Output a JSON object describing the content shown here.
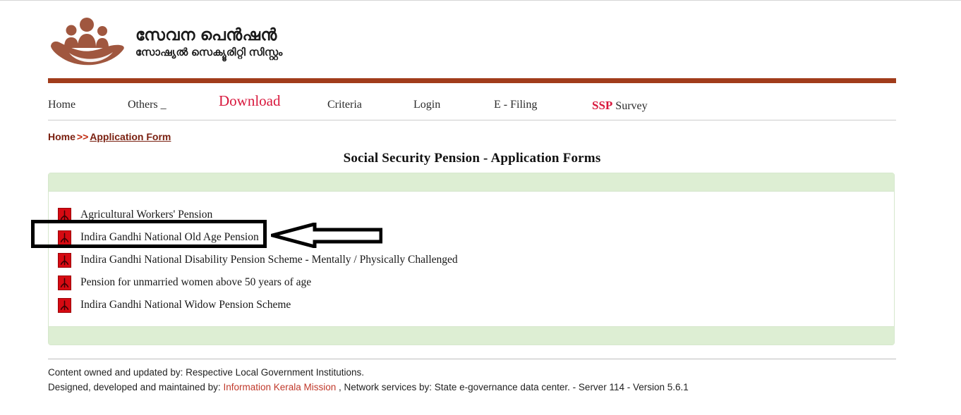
{
  "site": {
    "logo_icon": "hand-holding-people-icon",
    "title_ml": "സേവന പെൻഷൻ",
    "subtitle_ml": "സോഷ്യൽ സെക്യൂരിറ്റി സിസ്റ്റം",
    "accent_brown": "#a13c1b",
    "accent_red": "#d8173c",
    "panel_green": "#ddeed3"
  },
  "nav": {
    "items": [
      {
        "label": "Home"
      },
      {
        "label": "Others _"
      },
      {
        "label": "Download"
      },
      {
        "label": "Criteria"
      },
      {
        "label": "Login"
      },
      {
        "label": "E - Filing"
      },
      {
        "label": "SSP Survey",
        "accent_prefix": "SSP",
        "rest": " Survey"
      }
    ]
  },
  "breadcrumb": {
    "home": "Home",
    "separator": ">>",
    "current": "Application Form"
  },
  "page": {
    "title": "Social Security Pension - Application Forms"
  },
  "forms": {
    "items": [
      {
        "label": "Agricultural Workers' Pension",
        "icon": "pdf-icon"
      },
      {
        "label": "Indira Gandhi National Old Age Pension",
        "icon": "pdf-icon"
      },
      {
        "label": "Indira Gandhi National Disability Pension Scheme - Mentally / Physically Challenged",
        "icon": "pdf-icon"
      },
      {
        "label": "Pension for unmarried women above 50 years of age",
        "icon": "pdf-icon"
      },
      {
        "label": "Indira Gandhi National Widow Pension Scheme",
        "icon": "pdf-icon"
      }
    ]
  },
  "footer": {
    "line1": "Content owned and updated by: Respective Local Government Institutions.",
    "line2_prefix": "Designed, developed and maintained by: ",
    "line2_link": "Information Kerala Mission",
    "line2_suffix": " , Network services by: State e-governance data center. - Server 114 - Version 5.6.1"
  },
  "annotation": {
    "highlight_target": "Indira Gandhi National Old Age Pension",
    "arrow_direction": "left"
  }
}
